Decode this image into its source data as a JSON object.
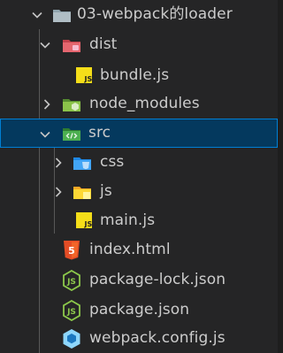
{
  "explorer": {
    "root": {
      "label": "03-webpack的loader",
      "icon": "folder-icon",
      "expanded": true
    },
    "dist": {
      "label": "dist",
      "icon": "dist-folder-icon",
      "expanded": true
    },
    "bundle": {
      "label": "bundle.js",
      "icon": "js-file-icon"
    },
    "node_modules": {
      "label": "node_modules",
      "icon": "node-folder-icon",
      "expanded": false
    },
    "src": {
      "label": "src",
      "icon": "src-folder-icon",
      "expanded": true,
      "selected": true
    },
    "css": {
      "label": "css",
      "icon": "css-folder-icon",
      "expanded": false
    },
    "js": {
      "label": "js",
      "icon": "js-folder-icon",
      "expanded": false
    },
    "main": {
      "label": "main.js",
      "icon": "js-file-icon"
    },
    "index": {
      "label": "index.html",
      "icon": "html-file-icon"
    },
    "package_lock": {
      "label": "package-lock.json",
      "icon": "nodejs-file-icon"
    },
    "package": {
      "label": "package.json",
      "icon": "nodejs-file-icon"
    },
    "webpack_config": {
      "label": "webpack.config.js",
      "icon": "webpack-file-icon"
    }
  },
  "colors": {
    "background": "#252526",
    "selected_background": "#04395e",
    "selected_border": "#007fd4",
    "text": "#cccccc",
    "js_badge": "#f5de19",
    "dist_folder": "#e5666f",
    "node_folder": "#8bc34a",
    "src_folder": "#4caf50",
    "css_folder": "#42a5f5",
    "html": "#e44d26"
  }
}
